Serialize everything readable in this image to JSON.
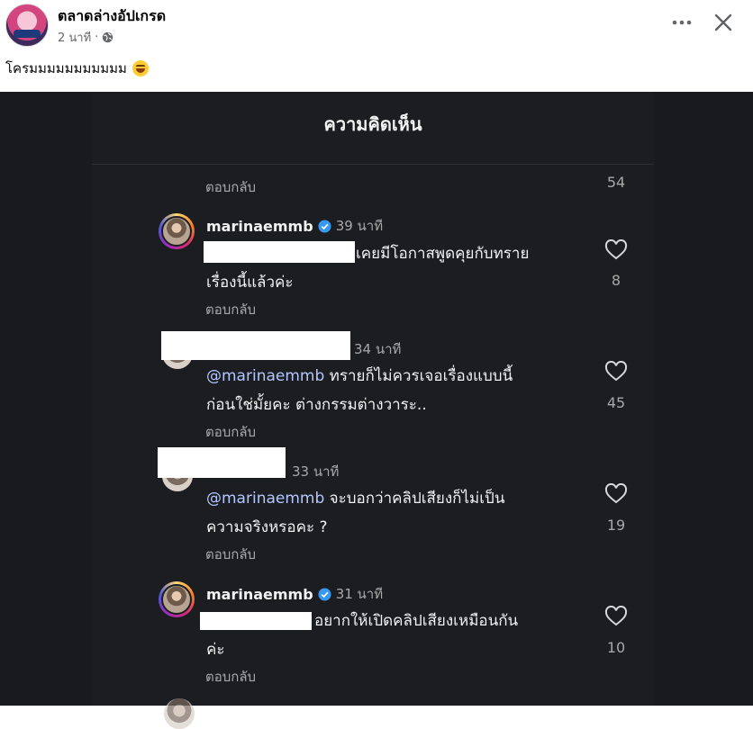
{
  "post": {
    "page_name": "ตลาดล่างอัปเกรด",
    "time": "2 นาที",
    "separator": "·",
    "caption": "โครมมมมมมมมมมม"
  },
  "icons": {
    "privacy": "globe-icon",
    "more": "more-icon",
    "close": "close-icon",
    "emoji": "grinning-face-emoji",
    "like": "heart-icon",
    "verified": "verified-badge-icon"
  },
  "sheet": {
    "title": "ความคิดเห็น",
    "top_reply_label": "ตอบกลับ",
    "top_count": "54"
  },
  "comments": [
    {
      "username": "marinaemmb",
      "time": "39 นาที",
      "lines": [
        "เคยมีโอกาสพูดคุยกับทราย",
        "เรื่องนี้แล้วค่ะ"
      ],
      "reply_label": "ตอบกลับ",
      "likes": "8"
    },
    {
      "time": "34 นาที",
      "mention": "@marinaemmb",
      "lines": [
        "ทรายก็ไม่ควรเจอเรื่องแบบนี้",
        "ก่อนใช่มั้ยคะ ต่างกรรมต่างวาระ.."
      ],
      "reply_label": "ตอบกลับ",
      "likes": "45"
    },
    {
      "time": "33 นาที",
      "mention": "@marinaemmb",
      "lines": [
        "จะบอกว่าคลิปเสียงก็ไม่เป็น",
        "ความจริงหรอคะ ?"
      ],
      "reply_label": "ตอบกลับ",
      "likes": "19"
    },
    {
      "username": "marinaemmb",
      "time": "31 นาที",
      "lines": [
        "อยากให้เปิดคลิปเสียงเหมือนกัน",
        "ค่ะ"
      ],
      "reply_label": "ตอบกลับ",
      "likes": "10"
    }
  ],
  "colors": {
    "verified_blue": "#3897f0",
    "mention": "#b3c7ff",
    "sheet_bg": "#1c1d21"
  }
}
